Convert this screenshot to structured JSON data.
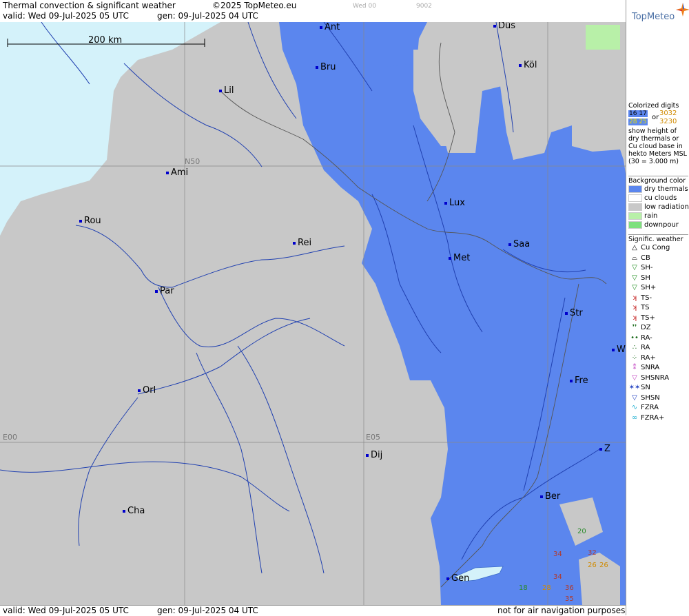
{
  "header": {
    "title": "Thermal convection & significant weather",
    "copyright": "©2025 TopMeteo.eu",
    "small1": "Wed 00",
    "small2": "9002",
    "valid": "valid:  Wed  09-Jul-2025  05 UTC",
    "gen": "gen: 09-Jul-2025 04 UTC"
  },
  "logo": {
    "text": "TopMeteo"
  },
  "scale": {
    "label": "200 km"
  },
  "grid_labels": {
    "n50": "N50",
    "e00": "E00",
    "e05": "E05"
  },
  "cities": [
    {
      "id": "ant",
      "name": "Ant"
    },
    {
      "id": "dus",
      "name": "Düs"
    },
    {
      "id": "bru",
      "name": "Bru"
    },
    {
      "id": "kol",
      "name": "Köl"
    },
    {
      "id": "lil",
      "name": "Lil"
    },
    {
      "id": "ami",
      "name": "Ami"
    },
    {
      "id": "lux",
      "name": "Lux"
    },
    {
      "id": "rou",
      "name": "Rou"
    },
    {
      "id": "rei",
      "name": "Rei"
    },
    {
      "id": "saa",
      "name": "Saa"
    },
    {
      "id": "met",
      "name": "Met"
    },
    {
      "id": "par",
      "name": "Par"
    },
    {
      "id": "str",
      "name": "Str"
    },
    {
      "id": "w",
      "name": "W"
    },
    {
      "id": "fre",
      "name": "Fre"
    },
    {
      "id": "orl",
      "name": "Orl"
    },
    {
      "id": "dij",
      "name": "Dij"
    },
    {
      "id": "z",
      "name": "Z"
    },
    {
      "id": "ber",
      "name": "Ber"
    },
    {
      "id": "cha",
      "name": "Cha"
    },
    {
      "id": "gen",
      "name": "Gen"
    }
  ],
  "digits": [
    {
      "id": "d20",
      "value": "20",
      "color": "#2a8a2a"
    },
    {
      "id": "d34a",
      "value": "34",
      "color": "#b03a2e"
    },
    {
      "id": "d32",
      "value": "32",
      "color": "#b03a2e"
    },
    {
      "id": "d26",
      "value": "26",
      "color": "#d08a00"
    },
    {
      "id": "d26b",
      "value": "26",
      "color": "#d08a00"
    },
    {
      "id": "d34b",
      "value": "34",
      "color": "#b03a2e"
    },
    {
      "id": "d18",
      "value": "18",
      "color": "#2a8a2a"
    },
    {
      "id": "d28",
      "value": "28",
      "color": "#d08a00"
    },
    {
      "id": "d36",
      "value": "36",
      "color": "#b03a2e"
    },
    {
      "id": "d35",
      "value": "35",
      "color": "#b03a2e"
    }
  ],
  "legend": {
    "colorized_title": "Colorized digits",
    "ex1": "16 17",
    "ex2": "3032",
    "or": "or",
    "ex3": "28 25",
    "ex4": "3230",
    "desc": "show height of dry thermals or Cu cloud base in hekto Meters MSL",
    "desc_note": "(30 = 3.000 m)",
    "bg_title": "Background color",
    "bg_items": [
      {
        "label": "dry thermals",
        "color": "#5b86ee"
      },
      {
        "label": "cu clouds",
        "color": "#ffffff"
      },
      {
        "label": "low radiation",
        "color": "#c8c8c8"
      },
      {
        "label": "rain",
        "color": "#b8f0a8"
      },
      {
        "label": "downpour",
        "color": "#7ee07e"
      }
    ],
    "sig_title": "Signific. weather",
    "sig_items": [
      {
        "label": "Cu Cong",
        "icon": "cu-cong",
        "symbol": "△",
        "color": "#000000"
      },
      {
        "label": "CB",
        "icon": "cb",
        "symbol": "⌓",
        "color": "#000000"
      },
      {
        "label": "SH-",
        "icon": "shower-light",
        "symbol": "▽",
        "color": "#1a8a1a"
      },
      {
        "label": "SH",
        "icon": "shower",
        "symbol": "▽",
        "color": "#1a8a1a"
      },
      {
        "label": "SH+",
        "icon": "shower-heavy",
        "symbol": "▽",
        "color": "#1a8a1a"
      },
      {
        "label": "TS-",
        "icon": "thunder-light",
        "symbol": "ʞ",
        "color": "#c01010"
      },
      {
        "label": "TS",
        "icon": "thunder",
        "symbol": "ʞ",
        "color": "#c01010"
      },
      {
        "label": "TS+",
        "icon": "thunder-heavy",
        "symbol": "ʞ",
        "color": "#c01010"
      },
      {
        "label": "DZ",
        "icon": "drizzle",
        "symbol": "❜❜",
        "color": "#1a6a1a"
      },
      {
        "label": "RA-",
        "icon": "rain-light",
        "symbol": "••",
        "color": "#1a6a1a"
      },
      {
        "label": "RA",
        "icon": "rain",
        "symbol": "∴",
        "color": "#1a6a1a"
      },
      {
        "label": "RA+",
        "icon": "rain-heavy",
        "symbol": "⁘",
        "color": "#1a6a1a"
      },
      {
        "label": "SNRA",
        "icon": "snow-rain",
        "symbol": "⁑",
        "color": "#c040c0"
      },
      {
        "label": "SHSNRA",
        "icon": "shower-snow-rain",
        "symbol": "▽",
        "color": "#c040c0"
      },
      {
        "label": "SN",
        "icon": "snow",
        "symbol": "✶✶",
        "color": "#2040c0"
      },
      {
        "label": "SHSN",
        "icon": "shower-snow",
        "symbol": "▽",
        "color": "#2040c0"
      },
      {
        "label": "FZRA",
        "icon": "freezing-rain",
        "symbol": "∿",
        "color": "#20b0d0"
      },
      {
        "label": "FZRA+",
        "icon": "freezing-rain-heavy",
        "symbol": "∞",
        "color": "#20b0d0"
      }
    ]
  },
  "footer": {
    "valid": "valid:  Wed  09-Jul-2025  05 UTC",
    "gen": "gen: 09-Jul-2025 04 UTC",
    "disclaimer": "not for air navigation purposes"
  }
}
